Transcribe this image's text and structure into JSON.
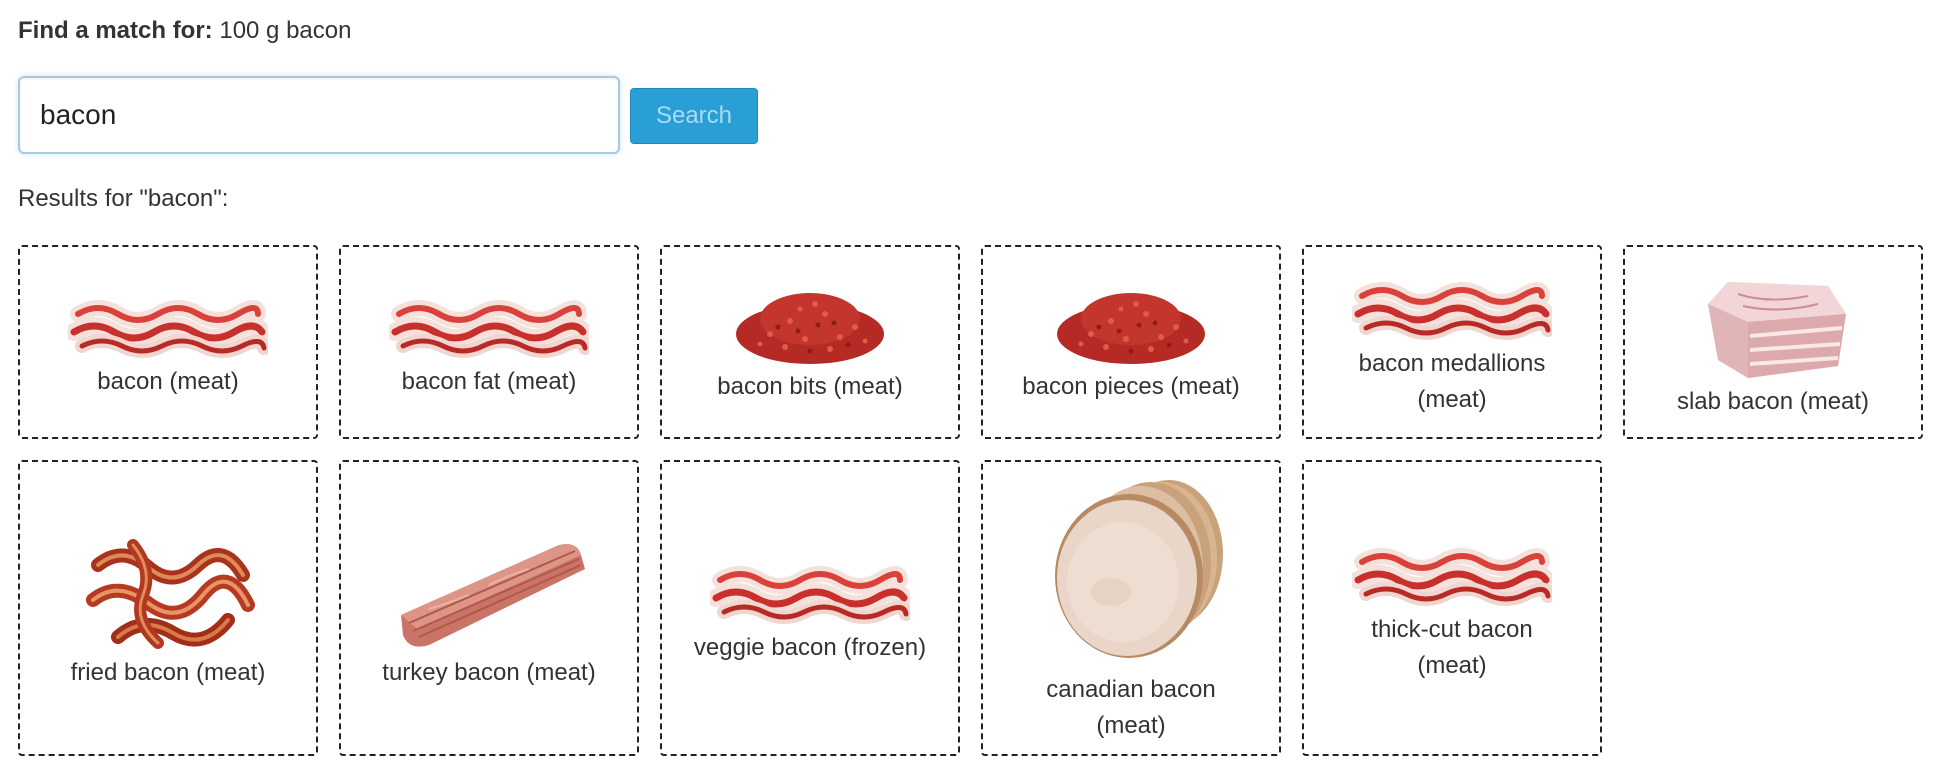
{
  "header": {
    "find_label": "Find a match for:",
    "find_value": "100 g bacon"
  },
  "search": {
    "value": "bacon",
    "button_label": "Search"
  },
  "results": {
    "label": "Results for \"bacon\":",
    "items": [
      {
        "name": "bacon (meat)",
        "image": "bacon-strips"
      },
      {
        "name": "bacon fat (meat)",
        "image": "bacon-strips"
      },
      {
        "name": "bacon bits (meat)",
        "image": "bacon-bits-pile"
      },
      {
        "name": "bacon pieces (meat)",
        "image": "bacon-bits-pile"
      },
      {
        "name": "bacon medallions (meat)",
        "image": "bacon-strips"
      },
      {
        "name": "slab bacon (meat)",
        "image": "pork-belly-slab"
      },
      {
        "name": "fried bacon (meat)",
        "image": "fried-bacon"
      },
      {
        "name": "turkey bacon (meat)",
        "image": "turkey-bacon-strips"
      },
      {
        "name": "veggie bacon (frozen)",
        "image": "bacon-strips"
      },
      {
        "name": "canadian bacon (meat)",
        "image": "canadian-bacon-slices"
      },
      {
        "name": "thick-cut bacon (meat)",
        "image": "bacon-strips"
      }
    ]
  },
  "colors": {
    "button_bg": "#2a9fd6",
    "button_text": "#a8dcf2",
    "input_border": "#a9cbd9",
    "card_border": "#222222",
    "bacon_lean": "#c8302c",
    "bacon_fat": "#f4e1dc",
    "bits": "#b52a24"
  }
}
